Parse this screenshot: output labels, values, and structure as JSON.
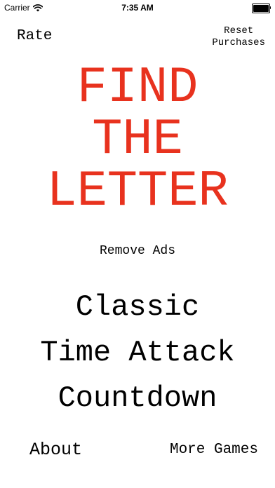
{
  "status_bar": {
    "carrier": "Carrier",
    "time": "7:35 AM",
    "wifi_icon": "wifi-icon",
    "battery_icon": "battery-full-icon"
  },
  "header": {
    "rate_label": "Rate",
    "reset_label": "Reset\nPurchases"
  },
  "title": {
    "lines": [
      "FIND",
      "THE",
      "LETTER"
    ],
    "color": "#e8321e"
  },
  "remove_ads_label": "Remove Ads",
  "modes": {
    "classic": "Classic",
    "time_attack": "Time Attack",
    "countdown": "Countdown"
  },
  "footer": {
    "about_label": "About",
    "more_games_label": "More Games"
  }
}
